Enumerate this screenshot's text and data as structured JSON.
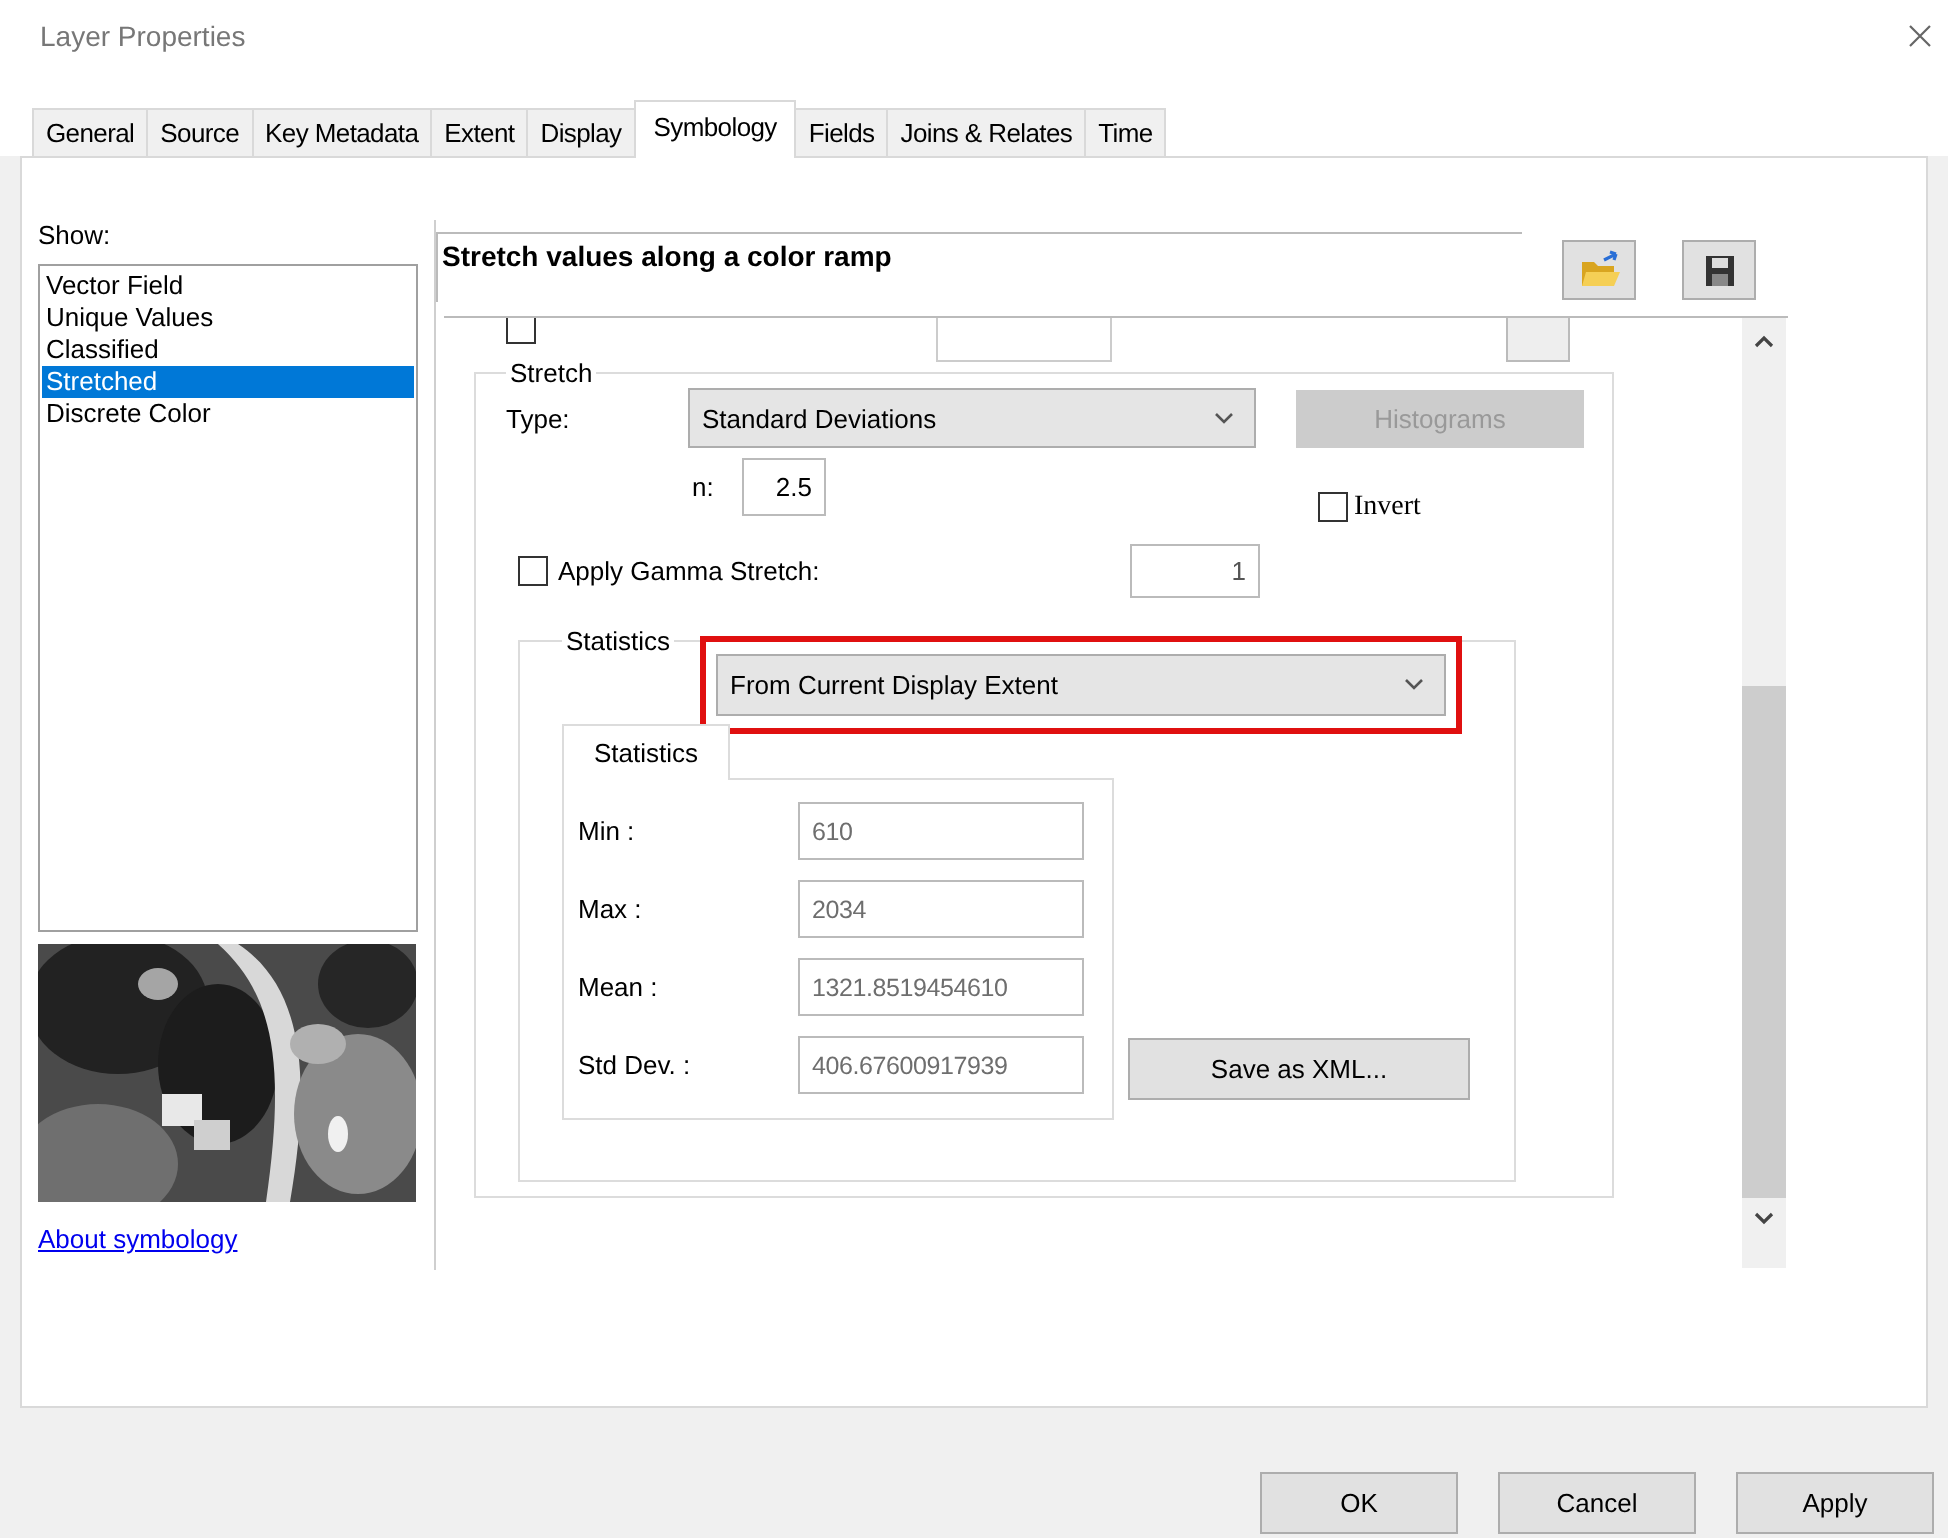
{
  "window": {
    "title": "Layer Properties"
  },
  "tabs": [
    {
      "label": "General",
      "selected": false
    },
    {
      "label": "Source",
      "selected": false
    },
    {
      "label": "Key Metadata",
      "selected": false
    },
    {
      "label": "Extent",
      "selected": false
    },
    {
      "label": "Display",
      "selected": false
    },
    {
      "label": "Symbology",
      "selected": true
    },
    {
      "label": "Fields",
      "selected": false
    },
    {
      "label": "Joins & Relates",
      "selected": false
    },
    {
      "label": "Time",
      "selected": false
    }
  ],
  "show": {
    "label": "Show:",
    "items": [
      {
        "label": "Vector Field",
        "selected": false
      },
      {
        "label": "Unique Values",
        "selected": false
      },
      {
        "label": "Classified",
        "selected": false
      },
      {
        "label": "Stretched",
        "selected": true
      },
      {
        "label": "Discrete Color",
        "selected": false
      }
    ]
  },
  "about_link": "About symbology",
  "renderer": {
    "description": "Stretch values along a color ramp"
  },
  "hillshade": {
    "checked": false
  },
  "stretch": {
    "legend": "Stretch",
    "type_label": "Type:",
    "type_value": "Standard Deviations",
    "histograms": {
      "label": "Histograms",
      "disabled": true
    },
    "n_label": "n:",
    "n_value": "2.5",
    "invert": {
      "label": "Invert",
      "checked": false
    },
    "gamma": {
      "label": "Apply Gamma Stretch:",
      "checked": false,
      "value": "1"
    }
  },
  "statistics": {
    "legend": "Statistics",
    "source": "From Current Display Extent",
    "highlighted": true,
    "tab": "Statistics",
    "save_button": "Save as XML...",
    "fields": [
      {
        "label": "Min :",
        "value": "610",
        "disabled": true
      },
      {
        "label": "Max :",
        "value": "2034",
        "disabled": true
      },
      {
        "label": "Mean :",
        "value": "1321.8519454610",
        "disabled": true
      },
      {
        "label": "Std Dev. :",
        "value": "406.67600917939",
        "disabled": true
      }
    ]
  },
  "buttons": [
    "OK",
    "Cancel",
    "Apply"
  ]
}
